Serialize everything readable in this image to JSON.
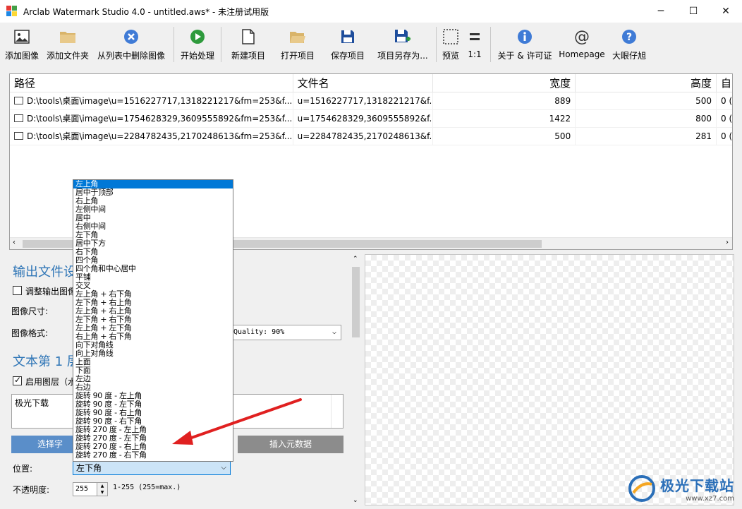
{
  "window": {
    "title": "Arclab Watermark Studio 4.0 - untitled.aws* - 未注册试用版",
    "controls": {
      "minimize": "─",
      "maximize": "☐",
      "close": "✕"
    }
  },
  "toolbar": {
    "add_image": "添加图像",
    "add_folder": "添加文件夹",
    "remove_image": "从列表中删除图像",
    "start": "开始处理",
    "new_project": "新建项目",
    "open_project": "打开项目",
    "save_project": "保存项目",
    "save_as": "项目另存为...",
    "preview": "预览",
    "one_to_one": "1:1",
    "about": "关于 & 许可证",
    "homepage": "Homepage",
    "big_eye": "大眼仔旭"
  },
  "file_list": {
    "columns": [
      "路径",
      "文件名",
      "宽度",
      "高度",
      "自"
    ],
    "rows": [
      {
        "path": "D:\\tools\\桌面\\image\\u=1516227717,1318221217&fm=253&f...",
        "name": "u=1516227717,1318221217&f...",
        "width": "889",
        "height": "500",
        "extra": "0 ("
      },
      {
        "path": "D:\\tools\\桌面\\image\\u=1754628329,3609555892&fm=253&f...",
        "name": "u=1754628329,3609555892&f...",
        "width": "1422",
        "height": "800",
        "extra": "0 ("
      },
      {
        "path": "D:\\tools\\桌面\\image\\u=2284782435,2170248613&fm=253&f...",
        "name": "u=2284782435,2170248613&f...",
        "width": "500",
        "height": "281",
        "extra": "0 ("
      }
    ]
  },
  "output": {
    "title": "输出文件设",
    "resize_label": "调整输出图像",
    "image_size_label": "图像尺寸:",
    "image_format_label": "图像格式:",
    "quality_value": "Quality: 90%"
  },
  "layer": {
    "title": "文本第 1 层",
    "enable_label": "启用图层（水",
    "text_value": "极光下载",
    "select_font_button": "选择字",
    "insert_meta_button": "插入元数据",
    "position_label": "位置:",
    "position_value": "左下角",
    "opacity_label": "不透明度:",
    "opacity_value": "255",
    "opacity_range": "1-255 (255=max.)"
  },
  "position_options": [
    "左上角",
    "居中于顶部",
    "右上角",
    "左侧中间",
    "居中",
    "右侧中间",
    "左下角",
    "居中下方",
    "右下角",
    "四个角",
    "四个角和中心居中",
    "平铺",
    "交叉",
    "左上角 + 右下角",
    "左下角 + 右上角",
    "左上角 + 右上角",
    "左下角 + 右下角",
    "左上角 + 左下角",
    "右上角 + 右下角",
    "向下对角线",
    "向上对角线",
    "上面",
    "下面",
    "左边",
    "右边",
    "旋转 90 度 - 左上角",
    "旋转 90 度 - 左下角",
    "旋转 90 度 - 右上角",
    "旋转 90 度 - 右下角",
    "旋转 270 度 - 左上角",
    "旋转 270 度 - 左下角",
    "旋转 270 度 - 右上角",
    "旋转 270 度 - 右下角"
  ],
  "watermark": {
    "main": "极光下载站",
    "sub": "www.xz7.com"
  },
  "colors": {
    "accent": "#0078d7",
    "section_title": "#2e75b6",
    "arrow": "#e02020"
  }
}
